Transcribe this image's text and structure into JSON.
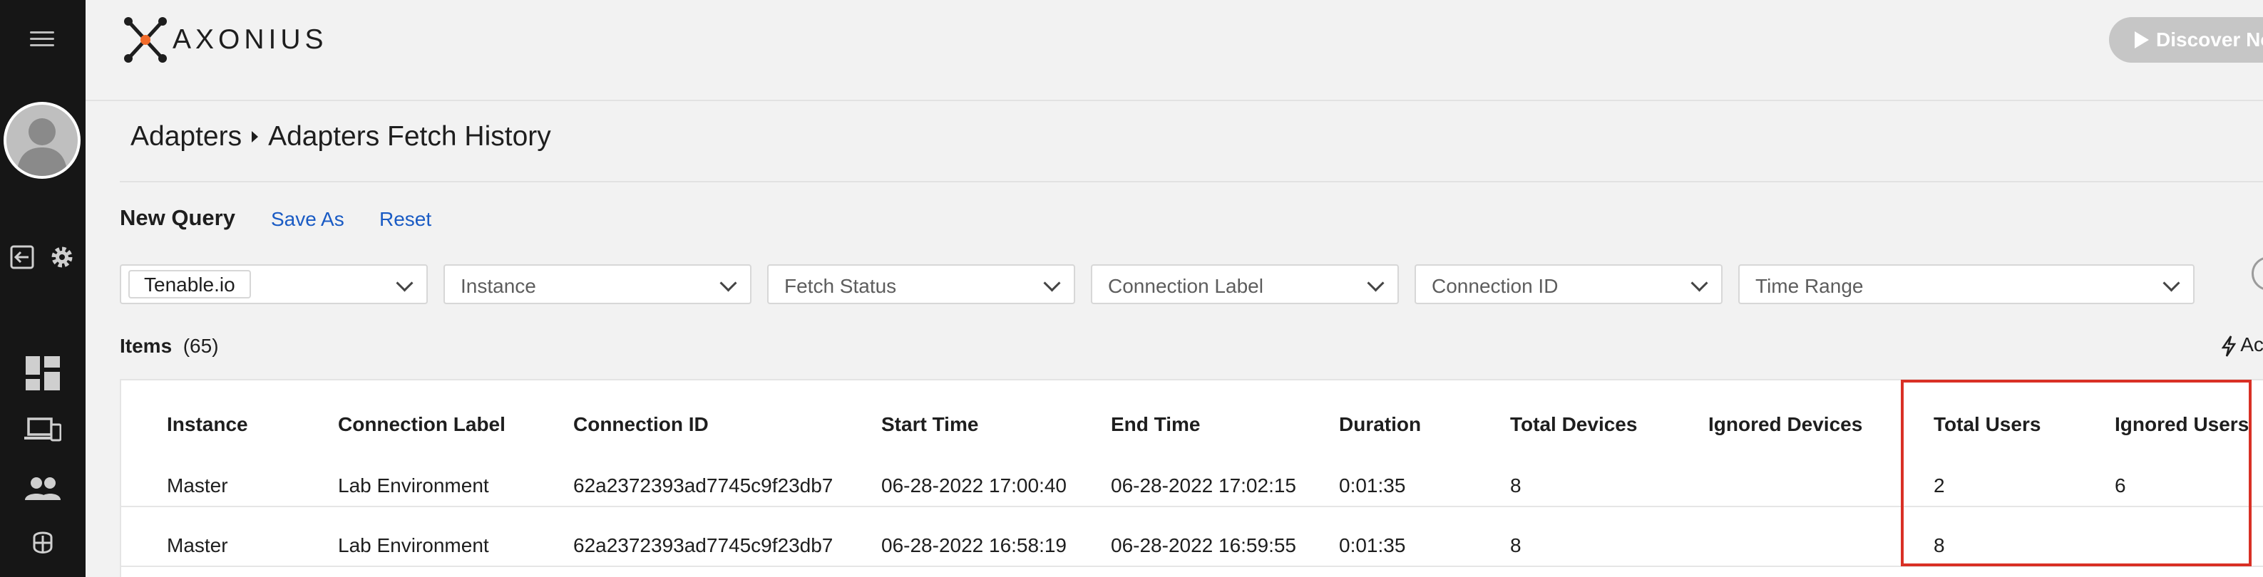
{
  "app": {
    "brand": "AXONIUS",
    "discover_label": "Discover Now"
  },
  "sidebar": {
    "icons": [
      "menu-icon",
      "avatar",
      "logout-icon",
      "gear-icon",
      "dashboard-icon",
      "devices-icon",
      "users-icon",
      "vulnerabilities-icon"
    ]
  },
  "breadcrumb": {
    "parent": "Adapters",
    "current": "Adapters Fetch History"
  },
  "query": {
    "title": "New Query",
    "save_as": "Save As",
    "reset": "Reset"
  },
  "filters": {
    "adapter_value": "Tenable.io",
    "instance": "Instance",
    "fetch_status": "Fetch Status",
    "connection_label": "Connection Label",
    "connection_id": "Connection ID",
    "time_range": "Time Range"
  },
  "items": {
    "label": "Items",
    "count": "(65)"
  },
  "actions_label": "Ac",
  "table": {
    "columns": [
      "Instance",
      "Connection Label",
      "Connection ID",
      "Start Time",
      "End Time",
      "Duration",
      "Total Devices",
      "Ignored Devices",
      "Total Users",
      "Ignored Users"
    ],
    "rows": [
      [
        "Master",
        "Lab Environment",
        "62a2372393ad7745c9f23db7",
        "06-28-2022 17:00:40",
        "06-28-2022 17:02:15",
        "0:01:35",
        "8",
        "",
        "2",
        "6"
      ],
      [
        "Master",
        "Lab Environment",
        "62a2372393ad7745c9f23db7",
        "06-28-2022 16:58:19",
        "06-28-2022 16:59:55",
        "0:01:35",
        "8",
        "",
        "8",
        ""
      ]
    ]
  },
  "colors": {
    "sidebar_bg": "#161616",
    "page_bg": "#f2f2f2",
    "link": "#1a5bc4",
    "highlight": "#d93025",
    "logo_accent": "#f26b2a"
  }
}
